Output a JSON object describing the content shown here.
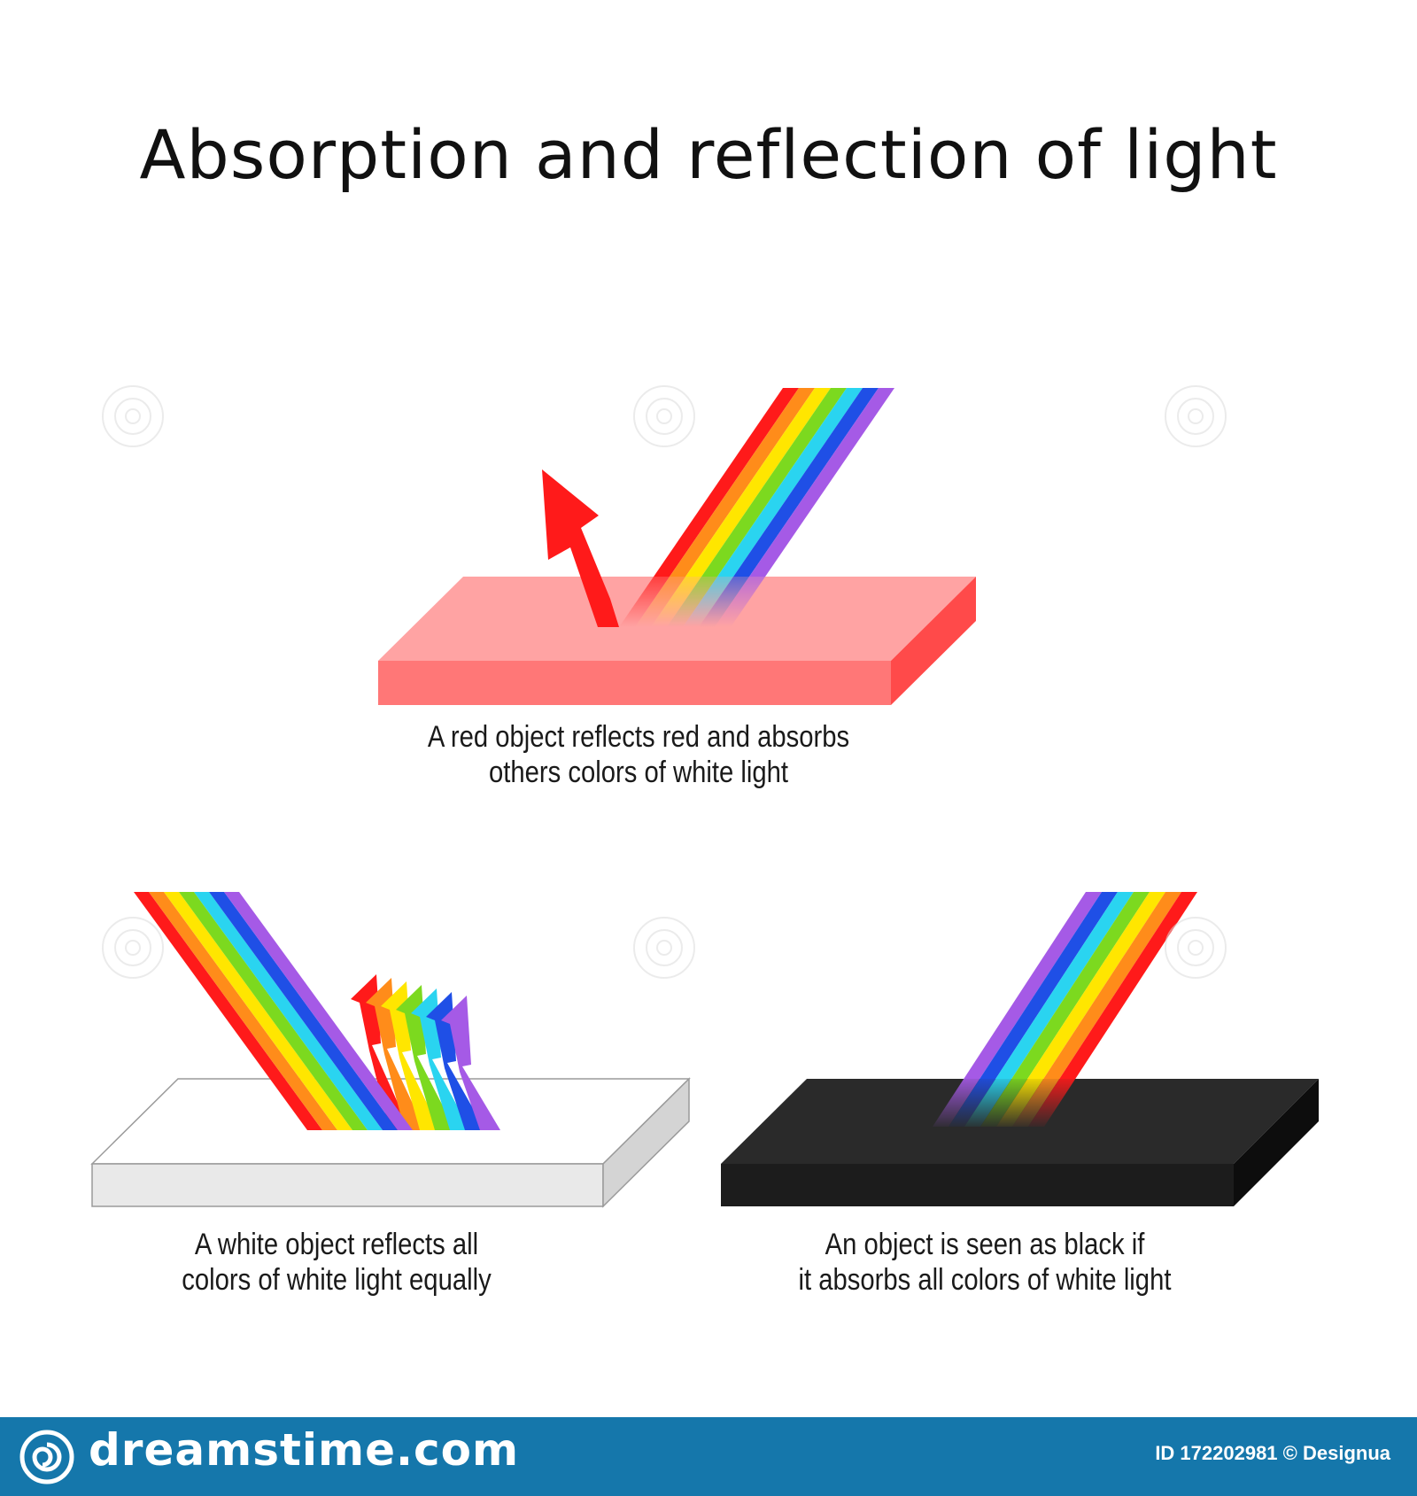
{
  "title": "Absorption and reflection of light",
  "panels": {
    "red_object": {
      "caption_line1": "A red object reflects red and absorbs",
      "caption_line2": "others colors of white light"
    },
    "white_object": {
      "caption_line1": "A white object reflects all",
      "caption_line2": "colors of white light equally"
    },
    "black_object": {
      "caption_line1": "An object is seen as black if",
      "caption_line2": "it absorbs all colors of white light"
    }
  },
  "spectrum_colors": [
    "#ff1a1a",
    "#ff8c1a",
    "#ffe600",
    "#7cd91f",
    "#2ad4f0",
    "#1f4fe6",
    "#a55ae6"
  ],
  "surface_colors": {
    "red_top": "#ffa3a3",
    "red_front": "#ff7777",
    "red_side": "#ff4a4a",
    "white_top": "#ffffff",
    "white_front": "#e9e9e9",
    "white_side": "#d4d4d4",
    "black_top": "#2a2a2a",
    "black_front": "#1c1c1c",
    "black_side": "#0d0d0d"
  },
  "footer": {
    "brand": "dreamstime.com",
    "credit": "ID 172202981 © Designua",
    "bar_color": "#1577ab"
  }
}
